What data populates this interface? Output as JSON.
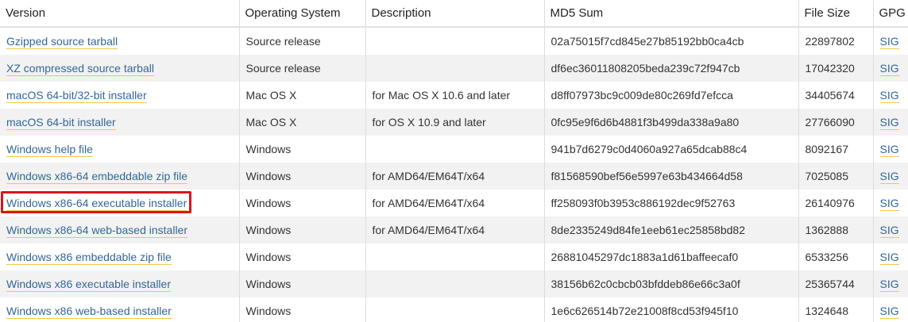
{
  "table": {
    "headers": {
      "version": "Version",
      "os": "Operating System",
      "description": "Description",
      "md5": "MD5 Sum",
      "size": "File Size",
      "gpg": "GPG"
    },
    "highlight_color": "#d9141b",
    "link_color": "#336699",
    "rows": [
      {
        "version": "Gzipped source tarball",
        "os": "Source release",
        "description": "",
        "md5": "02a75015f7cd845e27b85192bb0ca4cb",
        "size": "22897802",
        "gpg": "SIG"
      },
      {
        "version": "XZ compressed source tarball",
        "os": "Source release",
        "description": "",
        "md5": "df6ec36011808205beda239c72f947cb",
        "size": "17042320",
        "gpg": "SIG"
      },
      {
        "version": "macOS 64-bit/32-bit installer",
        "os": "Mac OS X",
        "description": "for Mac OS X 10.6 and later",
        "md5": "d8ff07973bc9c009de80c269fd7efcca",
        "size": "34405674",
        "gpg": "SIG"
      },
      {
        "version": "macOS 64-bit installer",
        "os": "Mac OS X",
        "description": "for OS X 10.9 and later",
        "md5": "0fc95e9f6d6b4881f3b499da338a9a80",
        "size": "27766090",
        "gpg": "SIG"
      },
      {
        "version": "Windows help file",
        "os": "Windows",
        "description": "",
        "md5": "941b7d6279c0d4060a927a65dcab88c4",
        "size": "8092167",
        "gpg": "SIG"
      },
      {
        "version": "Windows x86-64 embeddable zip file",
        "os": "Windows",
        "description": "for AMD64/EM64T/x64",
        "md5": "f81568590bef56e5997e63b434664d58",
        "size": "7025085",
        "gpg": "SIG"
      },
      {
        "version": "Windows x86-64 executable installer",
        "os": "Windows",
        "description": "for AMD64/EM64T/x64",
        "md5": "ff258093f0b3953c886192dec9f52763",
        "size": "26140976",
        "gpg": "SIG",
        "highlighted": true
      },
      {
        "version": "Windows x86-64 web-based installer",
        "os": "Windows",
        "description": "for AMD64/EM64T/x64",
        "md5": "8de2335249d84fe1eeb61ec25858bd82",
        "size": "1362888",
        "gpg": "SIG"
      },
      {
        "version": "Windows x86 embeddable zip file",
        "os": "Windows",
        "description": "",
        "md5": "26881045297dc1883a1d61baffeecaf0",
        "size": "6533256",
        "gpg": "SIG"
      },
      {
        "version": "Windows x86 executable installer",
        "os": "Windows",
        "description": "",
        "md5": "38156b62c0cbcb03bfddeb86e66c3a0f",
        "size": "25365744",
        "gpg": "SIG"
      },
      {
        "version": "Windows x86 web-based installer",
        "os": "Windows",
        "description": "",
        "md5": "1e6c626514b72e21008f8cd53f945f10",
        "size": "1324648",
        "gpg": "SIG"
      }
    ]
  }
}
